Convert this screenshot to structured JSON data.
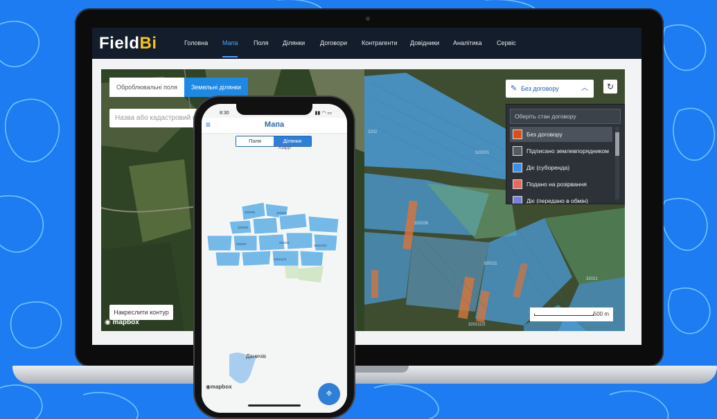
{
  "app": {
    "logo_main": "Field",
    "logo_accent": "Bi"
  },
  "nav": [
    {
      "label": "Головна",
      "active": false
    },
    {
      "label": "Мапа",
      "active": true
    },
    {
      "label": "Поля",
      "active": false
    },
    {
      "label": "Ділянки",
      "active": false
    },
    {
      "label": "Договори",
      "active": false
    },
    {
      "label": "Контрагенти",
      "active": false
    },
    {
      "label": "Довідники",
      "active": false
    },
    {
      "label": "Аналітика",
      "active": false
    },
    {
      "label": "Сервіс",
      "active": false
    }
  ],
  "map": {
    "toggle_processed": "Оброблювальні поля",
    "toggle_land": "Земельні ділянки",
    "search_placeholder": "Назва або кадастровий номер",
    "draw_button": "Накреслити контур",
    "mapbox": "mapbox",
    "scale_label": "500 m",
    "parcel_labels": [
      "320201",
      "320206",
      "320211",
      "3202",
      "320211/2",
      "32021"
    ]
  },
  "contract_filter": {
    "button_label": "Без договору",
    "search_placeholder": "Оберіть стан договору",
    "options": [
      {
        "label": "Без договору",
        "color": "#d84f1a",
        "selected": true
      },
      {
        "label": "Підписано землевпорядником",
        "color": "#555a60",
        "selected": false
      },
      {
        "label": "Діє (суборенда)",
        "color": "#3b8fe8",
        "selected": false
      },
      {
        "label": "Подано на розірвання",
        "color": "#e46a62",
        "selected": false
      },
      {
        "label": "Діє (передано в обмін)",
        "color": "#7b7fe0",
        "selected": false
      }
    ]
  },
  "phone": {
    "time": "8:30",
    "title": "Мапа",
    "tab_fields": "Поля",
    "tab_parcels": "Ділянки",
    "village_top": "Азаруї",
    "village": "Даничів",
    "mapbox": "mapbox",
    "parcel_labels": [
      "320205",
      "320201",
      "320206",
      "320207",
      "320211",
      "320210/2",
      "320211/2"
    ]
  },
  "colors": {
    "background": "#1d7cf2",
    "nav_bg": "#141d2b",
    "accent": "#4aa3ff",
    "parcel_blue": "#4da3e6",
    "parcel_orange": "#d9743a"
  }
}
